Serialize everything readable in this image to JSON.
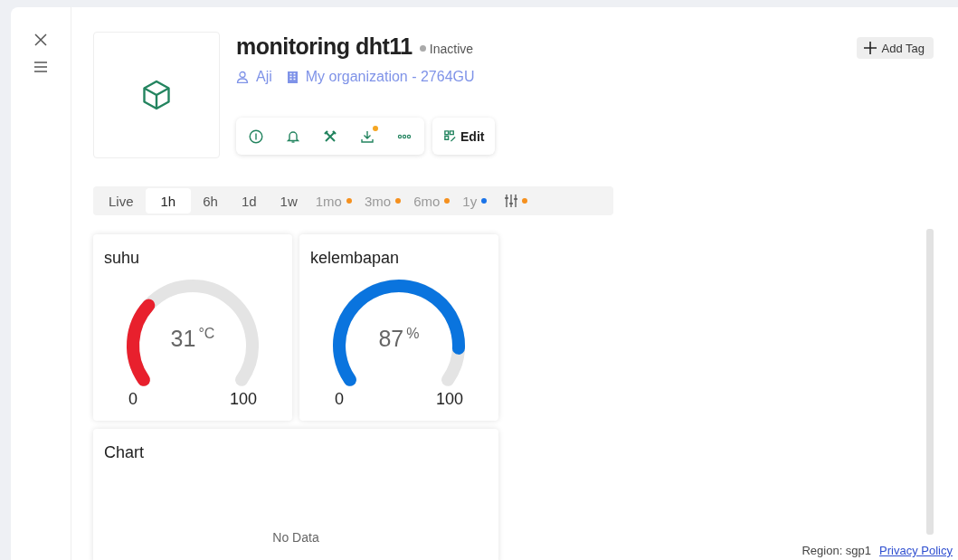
{
  "device": {
    "title": "monitoring dht11",
    "status": "Inactive",
    "owner": "Aji",
    "organization": "My organization - 2764GU"
  },
  "actions": {
    "edit_label": "Edit",
    "download_badge": true
  },
  "add_tag": {
    "label": "Add Tag"
  },
  "time_ranges": [
    {
      "kind": "text",
      "label": "Live",
      "selected": false
    },
    {
      "kind": "text",
      "label": "1h",
      "selected": true
    },
    {
      "kind": "text",
      "label": "6h",
      "selected": false
    },
    {
      "kind": "text",
      "label": "1d",
      "selected": false
    },
    {
      "kind": "text",
      "label": "1w",
      "selected": false
    },
    {
      "kind": "text",
      "label": "1mo",
      "selected": false,
      "color": "#f5901e"
    },
    {
      "kind": "text",
      "label": "3mo",
      "selected": false,
      "color": "#f5901e"
    },
    {
      "kind": "text",
      "label": "6mo",
      "selected": false,
      "color": "#f5901e"
    },
    {
      "kind": "text",
      "label": "1y",
      "selected": false,
      "color": "#1a73e8"
    },
    {
      "kind": "icon",
      "selected": false,
      "color": "#f5901e"
    }
  ],
  "gauges": [
    {
      "title": "suhu",
      "value": "31",
      "unit": "°C",
      "min": "0",
      "max": "100",
      "color": "#e8202d"
    },
    {
      "title": "kelembapan",
      "value": "87",
      "unit": "%",
      "min": "0",
      "max": "100",
      "color": "#0a74de"
    }
  ],
  "chart_card": {
    "title": "Chart",
    "empty_text": "No Data"
  },
  "footer": {
    "region": "Region: sgp1",
    "link": "Privacy Policy"
  }
}
